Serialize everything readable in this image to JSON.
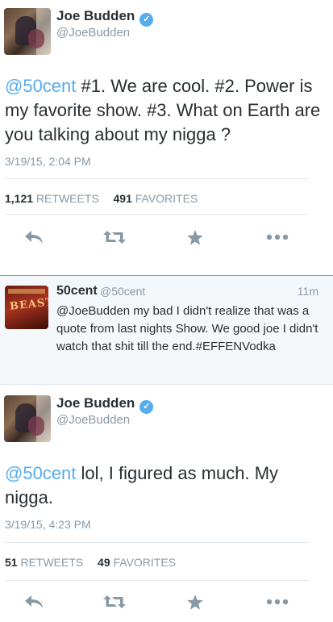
{
  "tweet1": {
    "name": "Joe Budden",
    "handle": "@JoeBudden",
    "mention": "@50cent",
    "text": " #1. We are cool. #2. Power is my favorite show. #3. What on Earth are you talking about my nigga ?",
    "timestamp": "3/19/15, 2:04 PM",
    "retweets_count": "1,121",
    "retweets_label": "RETWEETS",
    "favorites_count": "491",
    "favorites_label": "FAVORITES"
  },
  "reply": {
    "name": "50cent",
    "handle": "@50cent",
    "time": "11m",
    "text": "@JoeBudden my bad I didn't realize that was a quote from last nights Show. We good joe I didn't watch that shit till the end.#EFFENVodka",
    "avatar_text": "BEAST"
  },
  "tweet2": {
    "name": "Joe Budden",
    "handle": "@JoeBudden",
    "mention": "@50cent",
    "text": " lol, I figured as much. My nigga.",
    "timestamp": "3/19/15, 4:23 PM",
    "retweets_count": "51",
    "retweets_label": "RETWEETS",
    "favorites_count": "49",
    "favorites_label": "FAVORITES"
  },
  "icons": {
    "verified": "verified-badge-icon",
    "reply": "reply-icon",
    "retweet": "retweet-icon",
    "favorite": "star-icon",
    "more": "more-dots-icon"
  },
  "colors": {
    "accent": "#55acee",
    "text": "#292f33",
    "muted": "#8899a6",
    "card_background": "#f5f8fa"
  }
}
